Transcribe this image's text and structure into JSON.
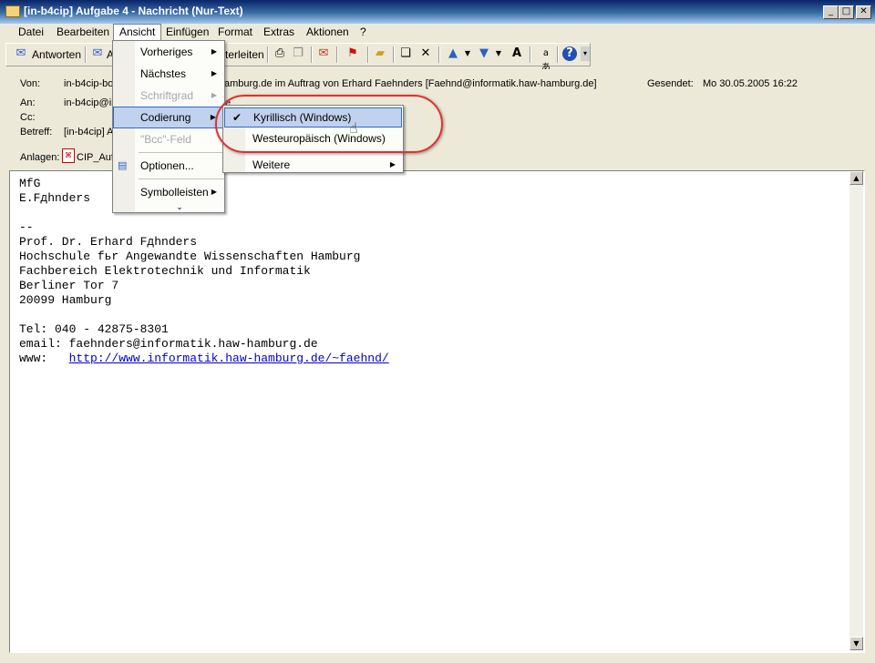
{
  "window": {
    "title": "[in-b4cip] Aufgabe 4 - Nachricht (Nur-Text)",
    "minimize": "_",
    "maximize": "□",
    "close": "✕"
  },
  "menubar": [
    "Datei",
    "Bearbeiten",
    "Ansicht",
    "Einfügen",
    "Format",
    "Extras",
    "Aktionen",
    "?"
  ],
  "toolbar": {
    "reply": "Antworten",
    "reply_all_partial": "A",
    "forward_partial": "terleiten"
  },
  "header": {
    "from_label": "Von:",
    "from_value": "in-b4cip-bo",
    "from_value_rest": "amburg.de im Auftrag von Erhard Faehnders [Faehnd@informatik.haw-hamburg.de]",
    "sent_label": "Gesendet:",
    "sent_value": "Mo 30.05.2005 16:22",
    "to_label": "An:",
    "to_value": "in-b4cip@in",
    "to_value_rest": "e",
    "cc_label": "Cc:",
    "subject_label": "Betreff:",
    "subject_value": "[in-b4cip] A",
    "attach_label": "Anlagen:",
    "attach_value": "CIP_Auf"
  },
  "body_lines": [
    "MfG",
    "E.Fдhnders",
    "",
    "--",
    "Prof. Dr. Erhard Fдhnders",
    "Hochschule fьr Angewandte Wissenschaften Hamburg",
    "Fachbereich Elektrotechnik und Informatik",
    "Berliner Tor 7",
    "20099 Hamburg",
    "",
    "Tel: 040 - 42875-8301",
    "email: faehnders@informatik.haw-hamburg.de",
    "www:   "
  ],
  "body_link": "http://www.informatik.haw-hamburg.de/~faehnd/",
  "ansicht_menu": [
    {
      "label": "Vorheriges",
      "disabled": false,
      "submenu": true
    },
    {
      "label": "Nächstes",
      "disabled": false,
      "submenu": true
    },
    {
      "label": "Schriftgrad",
      "disabled": true,
      "submenu": true
    },
    {
      "label": "Codierung",
      "disabled": false,
      "submenu": true,
      "highlighted": true
    },
    {
      "label": "\"Bcc\"-Feld",
      "disabled": true,
      "submenu": false
    },
    {
      "label": "Optionen...",
      "disabled": false,
      "submenu": false
    },
    {
      "label": "Symbolleisten",
      "disabled": false,
      "submenu": true
    }
  ],
  "codierung_menu": [
    {
      "label": "Kyrillisch (Windows)",
      "checked": true,
      "highlighted": true
    },
    {
      "label": "Westeuropäisch (Windows)",
      "checked": false
    },
    {
      "label": "Weitere",
      "submenu": true
    }
  ],
  "colors": {
    "titlebar": "#0a246a",
    "menu_highlight": "#c1d2ee",
    "annotation": "#e03030",
    "link": "#0000cc"
  }
}
